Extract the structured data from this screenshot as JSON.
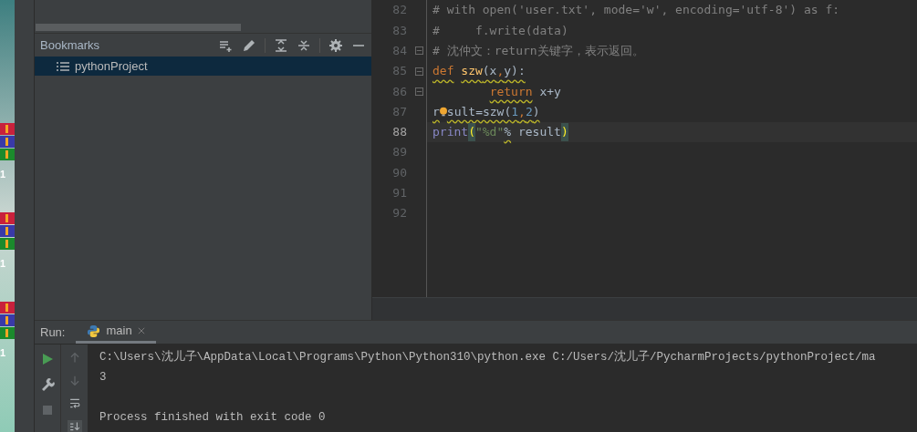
{
  "desktop": {
    "icons": [
      {
        "label": "1"
      },
      {
        "label": "1"
      },
      {
        "label": "1"
      }
    ]
  },
  "bookmarks": {
    "title": "Bookmarks",
    "items": [
      {
        "label": "pythonProject",
        "selected": true
      }
    ]
  },
  "editor": {
    "lines": [
      {
        "number": "82",
        "selected": false,
        "tokens": [
          {
            "kind": "comment",
            "text": "# with open('user.txt', mode='w', encoding='utf-8') as f:"
          }
        ]
      },
      {
        "number": "83",
        "selected": false,
        "tokens": [
          {
            "kind": "comment",
            "text": "#     f.write(data)"
          }
        ]
      },
      {
        "number": "84",
        "selected": false,
        "fold": true,
        "tokens": [
          {
            "kind": "comment",
            "text": "# 沈仲文：return关键字，表示返回。"
          }
        ]
      },
      {
        "number": "85",
        "selected": false,
        "fold": true,
        "tokens": [
          {
            "kind": "keyword",
            "text": "def",
            "warn": true
          },
          {
            "kind": "def",
            "text": " szw",
            "warn": true
          },
          {
            "kind": "plain",
            "text": "(x",
            "warn": true
          },
          {
            "kind": "keyword",
            "text": ",",
            "warn": true
          },
          {
            "kind": "plain",
            "text": "y):",
            "warn": true
          }
        ]
      },
      {
        "number": "86",
        "selected": false,
        "fold": true,
        "tokens": [
          {
            "kind": "keyword",
            "text": "        return",
            "warn": true
          },
          {
            "kind": "plain",
            "text": " x+y",
            "warn": false
          }
        ]
      },
      {
        "number": "87",
        "selected": false,
        "tokens": [
          {
            "kind": "plain",
            "text": "r",
            "warn": true
          },
          {
            "kind": "bulb"
          },
          {
            "kind": "plain",
            "text": "sult=szw(",
            "warn": true
          },
          {
            "kind": "number",
            "text": "1",
            "warn": true
          },
          {
            "kind": "keyword",
            "text": ",",
            "warn": true
          },
          {
            "kind": "number",
            "text": "2",
            "warn": true
          },
          {
            "kind": "plain",
            "text": ")",
            "warn": true
          }
        ]
      },
      {
        "number": "88",
        "selected": true,
        "tokens": [
          {
            "kind": "builtin",
            "text": "print"
          },
          {
            "kind": "paren",
            "text": "("
          },
          {
            "kind": "string",
            "text": "\"%d\""
          },
          {
            "kind": "plain",
            "text": "%",
            "warn": true
          },
          {
            "kind": "plain",
            "text": " result",
            "warn": false
          },
          {
            "kind": "paren",
            "text": ")"
          }
        ]
      },
      {
        "number": "89",
        "selected": false
      },
      {
        "number": "90",
        "selected": false
      },
      {
        "number": "91",
        "selected": false
      },
      {
        "number": "92",
        "selected": false
      }
    ]
  },
  "run": {
    "label": "Run:",
    "tabs": [
      {
        "label": "main",
        "selected": true
      }
    ],
    "output": [
      {
        "kind": "command",
        "text": "C:\\Users\\沈儿子\\AppData\\Local\\Programs\\Python\\Python310\\python.exe C:/Users/沈儿子/PycharmProjects/pythonProject/ma"
      },
      {
        "kind": "result",
        "text": "3"
      },
      {
        "kind": "status",
        "text": "Process finished with exit code 0"
      }
    ]
  }
}
